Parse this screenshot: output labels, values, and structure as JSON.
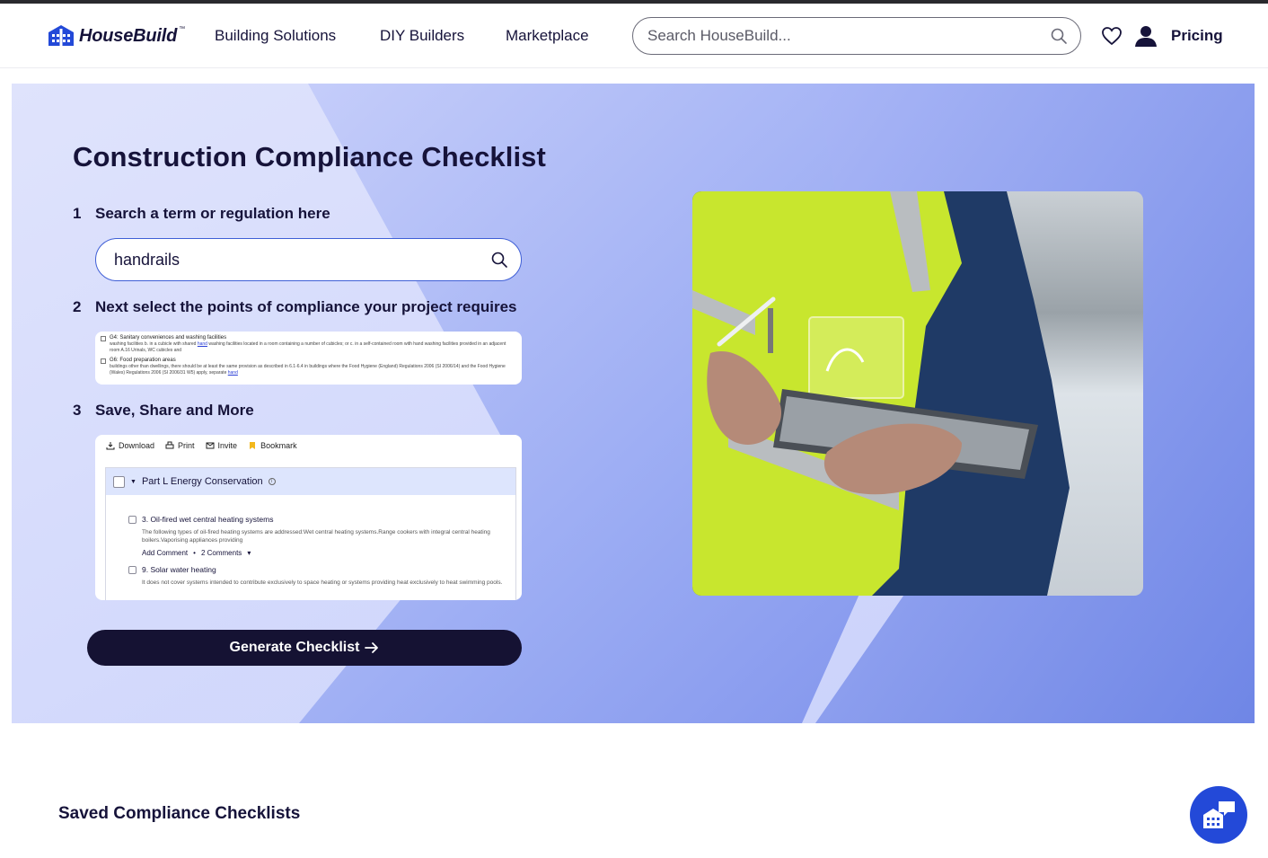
{
  "brand": {
    "name": "HouseBuild",
    "trademark": "™"
  },
  "nav": {
    "items": [
      {
        "label": "Building Solutions"
      },
      {
        "label": "DIY Builders"
      },
      {
        "label": "Marketplace"
      }
    ],
    "search_placeholder": "Search HouseBuild...",
    "pricing_label": "Pricing"
  },
  "hero": {
    "title": "Construction Compliance Checklist",
    "steps": [
      {
        "num": "1",
        "label": "Search a term or regulation here"
      },
      {
        "num": "2",
        "label": "Next select the points of compliance your project requires"
      },
      {
        "num": "3",
        "label": "Save, Share and More"
      }
    ],
    "search_value": "handrails",
    "generate_label": "Generate Checklist"
  },
  "preview_compliance": {
    "items": [
      {
        "title": "G4: Sanitary conveniences and washing facilities",
        "text_before": "washing facilities b. in a cubicle with shared ",
        "highlight": "hand",
        "text_after": " washing facilities located in a room containing a number of cubicles; or c. in a self-contained room with hand washing facilities provided in an adjacent room A.16 Urinals, WC cubicles and"
      },
      {
        "title": "G6: Food preparation areas",
        "text_before": "buildings other than dwellings, there should be at least the same provision as described in 6.1-6.4 in buildings where the Food Hygiene (England) Regulations 2006 (SI 2006/14) and the Food Hygiene (Wales) Regulations 2006 (SI 2006/31 W5) apply, separate ",
        "highlight": "hand",
        "text_after": ""
      }
    ]
  },
  "preview_save": {
    "toolbar": [
      {
        "label": "Download",
        "icon": "download-icon"
      },
      {
        "label": "Print",
        "icon": "print-icon"
      },
      {
        "label": "Invite",
        "icon": "mail-icon"
      },
      {
        "label": "Bookmark",
        "icon": "bookmark-icon"
      }
    ],
    "section_title": "Part L Energy Conservation",
    "item1_title": "3. Oil-fired wet central heating systems",
    "item1_desc": "The following types of oil-fired heating systems are addressed:Wet central heating systems.Range cookers with integral central heating boilers.Vaporising appliances providing",
    "add_comment": "Add Comment",
    "separator": "•",
    "comments": "2 Comments",
    "item2_title": "9. Solar water heating",
    "item2_desc": "It does not cover systems intended to contribute exclusively to space heating or systems providing heat exclusively to heat swimming pools."
  },
  "saved": {
    "title": "Saved Compliance Checklists"
  },
  "colors": {
    "navy": "#151233",
    "accent": "#2349d8",
    "hero_light": "#d6dcfb",
    "hero_dark": "#6f86e6"
  }
}
